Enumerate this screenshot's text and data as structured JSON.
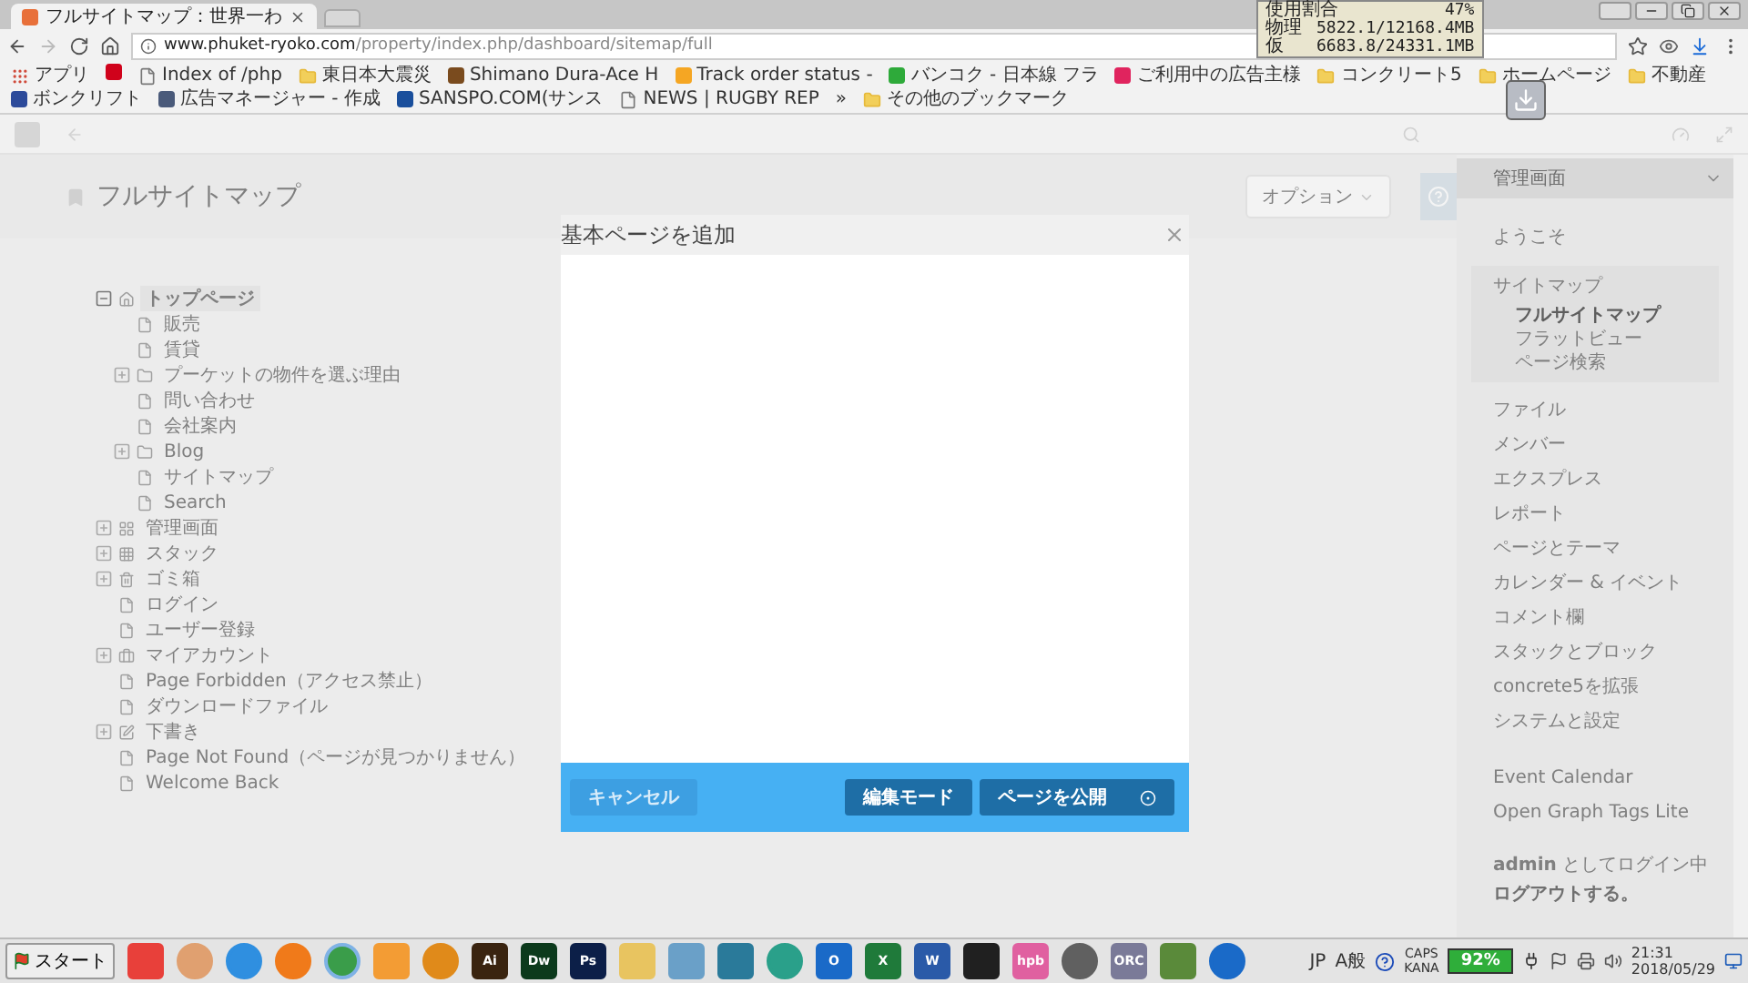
{
  "browser": {
    "tab": {
      "title": "フルサイトマップ：世界一わ"
    },
    "url": {
      "host": "www.phuket-ryoko.com",
      "path": "/property/index.php/dashboard/sitemap/full"
    },
    "bookmarks": [
      {
        "kind": "apps",
        "label": "アプリ"
      },
      {
        "kind": "site",
        "color": "#d0021b"
      },
      {
        "kind": "page",
        "label": "Index of /php"
      },
      {
        "kind": "folder",
        "label": "東日本大震災"
      },
      {
        "kind": "site",
        "color": "#7a4b1e",
        "label": "Shimano Dura-Ace H"
      },
      {
        "kind": "site",
        "color": "#f5a623",
        "label": "Track order status -"
      },
      {
        "kind": "site",
        "color": "#2eaa3a",
        "label": "バンコク - 日本線 フラ"
      },
      {
        "kind": "site",
        "color": "#e0245e",
        "label": "ご利用中の広告主様"
      },
      {
        "kind": "folder",
        "label": "コンクリート5"
      },
      {
        "kind": "folder",
        "label": "ホームページ"
      },
      {
        "kind": "folder",
        "label": "不動産"
      },
      {
        "kind": "site",
        "color": "#2c4a9a",
        "label": "ボンクリフト"
      },
      {
        "kind": "site",
        "color": "#4a5a7a",
        "label": "広告マネージャー - 作成"
      },
      {
        "kind": "site",
        "color": "#1a4f9c",
        "label": "SANSPO.COM(サンス"
      },
      {
        "kind": "page",
        "label": "NEWS | RUGBY REP"
      },
      {
        "kind": "more",
        "label": "»"
      },
      {
        "kind": "folder",
        "label": "その他のブックマーク"
      }
    ]
  },
  "memory_monitor": {
    "lines": [
      {
        "label": "使用割合",
        "value": "47%"
      },
      {
        "label": "物理",
        "value": "5822.1/12168.4MB"
      },
      {
        "label": "仮",
        "value": "6683.8/24331.1MB"
      }
    ]
  },
  "sitemap": {
    "title": "フルサイトマップ",
    "options_button": "オプション",
    "tree": [
      {
        "label": "トップページ",
        "kind": "home",
        "expanded": true,
        "selected": true,
        "children": [
          {
            "label": "販売",
            "kind": "page",
            "selected": false
          },
          {
            "label": "賃貸",
            "kind": "page",
            "selected": false
          },
          {
            "label": "プーケットの物件を選ぶ理由",
            "kind": "folder",
            "expanded": false,
            "selected": false
          },
          {
            "label": "問い合わせ",
            "kind": "page",
            "selected": false
          },
          {
            "label": "会社案内",
            "kind": "page",
            "selected": false
          },
          {
            "label": "Blog",
            "kind": "folder",
            "expanded": false,
            "selected": false
          },
          {
            "label": "サイトマップ",
            "kind": "page",
            "selected": false
          },
          {
            "label": "Search",
            "kind": "page",
            "selected": false
          }
        ]
      },
      {
        "label": "管理画面",
        "kind": "dashboard",
        "expanded": false,
        "selected": false
      },
      {
        "label": "スタック",
        "kind": "stacks",
        "expanded": false,
        "selected": false
      },
      {
        "label": "ゴミ箱",
        "kind": "trash",
        "expanded": false,
        "selected": false
      },
      {
        "label": "ログイン",
        "kind": "page",
        "selected": false
      },
      {
        "label": "ユーザー登録",
        "kind": "page",
        "selected": false
      },
      {
        "label": "マイアカウント",
        "kind": "account",
        "expanded": false,
        "selected": false
      },
      {
        "label": "Page Forbidden（アクセス禁止）",
        "kind": "page",
        "selected": false
      },
      {
        "label": "ダウンロードファイル",
        "kind": "page",
        "selected": false
      },
      {
        "label": "下書き",
        "kind": "drafts",
        "expanded": false,
        "selected": false
      },
      {
        "label": "Page Not Found（ページが見つかりません）",
        "kind": "page",
        "selected": false
      },
      {
        "label": "Welcome Back",
        "kind": "page",
        "selected": false
      }
    ]
  },
  "dashboard_panel": {
    "title": "管理画面",
    "items": [
      {
        "label": "ようこそ",
        "selected": false
      },
      {
        "label": "サイトマップ",
        "selected": false,
        "expanded": true,
        "children": [
          {
            "label": "フルサイトマップ",
            "selected": true
          },
          {
            "label": "フラットビュー",
            "selected": false
          },
          {
            "label": "ページ検索",
            "selected": false
          }
        ]
      },
      {
        "label": "ファイル",
        "selected": false
      },
      {
        "label": "メンバー",
        "selected": false
      },
      {
        "label": "エクスプレス",
        "selected": false
      },
      {
        "label": "レポート",
        "selected": false
      },
      {
        "label": "ページとテーマ",
        "selected": false
      },
      {
        "label": "カレンダー & イベント",
        "selected": false
      },
      {
        "label": "コメント欄",
        "selected": false
      },
      {
        "label": "スタックとブロック",
        "selected": false
      },
      {
        "label": "concrete5を拡張",
        "selected": false
      },
      {
        "label": "システムと設定",
        "selected": false
      }
    ],
    "extensions": [
      {
        "label": "Event Calendar",
        "selected": false
      },
      {
        "label": "Open Graph Tags Lite",
        "selected": false
      }
    ],
    "login_status": "**admin** としてログイン中",
    "logout_link": "ログアウトする。"
  },
  "dialog": {
    "title": "基本ページを追加",
    "buttons": [
      {
        "label": "キャンセル",
        "kind": "cancel"
      },
      {
        "label": "編集モード",
        "kind": "secondary"
      },
      {
        "label": "ページを公開",
        "kind": "publish"
      }
    ]
  },
  "taskbar": {
    "start": "スタート",
    "apps": [
      {
        "kind": "tile",
        "color": "#e8403a",
        "selected": false
      },
      {
        "kind": "circle",
        "color": "#e0a070",
        "selected": false
      },
      {
        "kind": "circle",
        "color": "#2f8fe0",
        "selected": false
      },
      {
        "kind": "circle",
        "color": "#f07a1a",
        "selected": false
      },
      {
        "kind": "circle",
        "color": "#3a9d4a",
        "selected": true
      },
      {
        "kind": "tile",
        "color": "#f39c34",
        "selected": false
      },
      {
        "kind": "circle",
        "color": "#e08a1a",
        "selected": false
      },
      {
        "kind": "tile",
        "color": "#3a2410",
        "label": "Ai",
        "selected": false
      },
      {
        "kind": "tile",
        "color": "#0c3a1c",
        "label": "Dw",
        "selected": false
      },
      {
        "kind": "tile",
        "color": "#0c1f48",
        "label": "Ps",
        "selected": false
      },
      {
        "kind": "tile",
        "color": "#e8c460",
        "selected": false
      },
      {
        "kind": "tile",
        "color": "#6aa0c8",
        "selected": false
      },
      {
        "kind": "tile",
        "color": "#2a7a9a",
        "selected": false
      },
      {
        "kind": "circle",
        "color": "#2aa08a",
        "selected": false
      },
      {
        "kind": "tile",
        "color": "#1a6ac8",
        "label": "O",
        "selected": false
      },
      {
        "kind": "tile",
        "color": "#1f7a3a",
        "label": "X",
        "selected": false
      },
      {
        "kind": "tile",
        "color": "#2a5aa8",
        "label": "W",
        "selected": false
      },
      {
        "kind": "tile",
        "color": "#202020",
        "selected": false
      },
      {
        "kind": "tile",
        "color": "#e060a0",
        "label": "hpb",
        "selected": false
      },
      {
        "kind": "circle",
        "color": "#606060",
        "selected": false
      },
      {
        "kind": "tile",
        "color": "#7a7a98",
        "label": "ORC",
        "selected": false
      },
      {
        "kind": "tile",
        "color": "#5a8a3a",
        "selected": false
      },
      {
        "kind": "circle",
        "color": "#1a6ac8",
        "selected": false
      }
    ],
    "ime": "JP",
    "ime_mode": "A般",
    "caps": "CAPS",
    "kana": "KANA",
    "battery": "92%",
    "time": "21:31",
    "date": "2018/05/29"
  }
}
